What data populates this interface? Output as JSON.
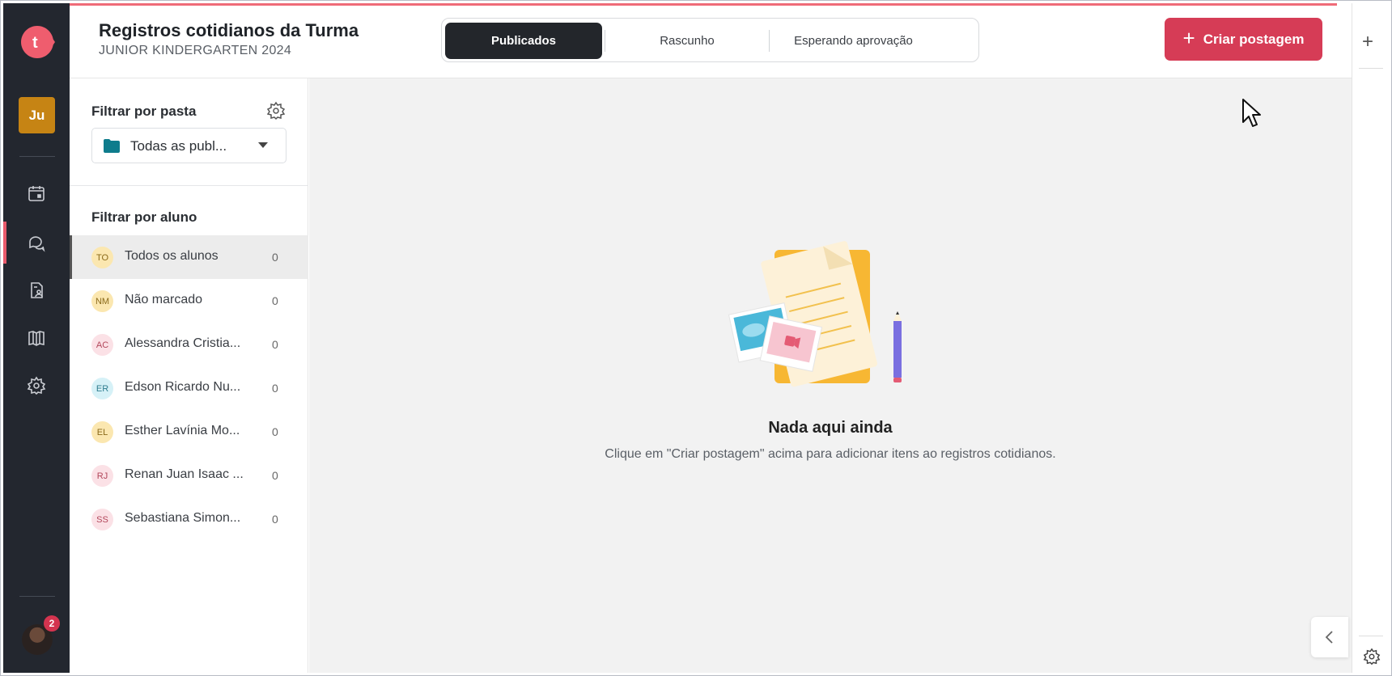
{
  "header": {
    "title": "Registros cotidianos da Turma",
    "subtitle": "JUNIOR KINDERGARTEN 2024",
    "tabs": [
      {
        "label": "Publicados",
        "active": true
      },
      {
        "label": "Rascunho",
        "active": false
      },
      {
        "label": "Esperando aprovação",
        "active": false
      }
    ],
    "create_button": "Criar postagem"
  },
  "rail": {
    "class_avatar": "Ju",
    "notification_count": "2",
    "icons": [
      "logo-icon",
      "calendar-icon",
      "chat-icon",
      "document-user-icon",
      "book-icon",
      "gear-icon"
    ]
  },
  "filters": {
    "folder_label": "Filtrar por pasta",
    "folder_selected": "Todas as publ...",
    "student_label": "Filtrar por aluno",
    "students": [
      {
        "initials": "TO",
        "name": "Todos os alunos",
        "count": "0",
        "active": true,
        "color": "#fbe7b0",
        "text_color": "#8a6a1a"
      },
      {
        "initials": "NM",
        "name": "Não marcado",
        "count": "0",
        "active": false,
        "color": "#fbe7b0",
        "text_color": "#8a6a1a"
      },
      {
        "initials": "AC",
        "name": "Alessandra Cristia...",
        "count": "0",
        "active": false,
        "color": "#fbe1e6",
        "text_color": "#b2475b"
      },
      {
        "initials": "ER",
        "name": "Edson Ricardo Nu...",
        "count": "0",
        "active": false,
        "color": "#d6f1f7",
        "text_color": "#2f7d8f"
      },
      {
        "initials": "EL",
        "name": "Esther Lavínia Mo...",
        "count": "0",
        "active": false,
        "color": "#fbe7b0",
        "text_color": "#8a6a1a"
      },
      {
        "initials": "RJ",
        "name": "Renan Juan Isaac ...",
        "count": "0",
        "active": false,
        "color": "#fbe1e6",
        "text_color": "#b2475b"
      },
      {
        "initials": "SS",
        "name": "Sebastiana Simon...",
        "count": "0",
        "active": false,
        "color": "#fbe1e6",
        "text_color": "#b2475b"
      }
    ]
  },
  "main": {
    "empty_title": "Nada aqui ainda",
    "empty_desc": "Clique em \"Criar postagem\" acima para adicionar itens ao registros cotidianos."
  },
  "colors": {
    "accent": "#d63c56",
    "rail_bg": "#23272f",
    "main_bg": "#f2f2f2"
  }
}
